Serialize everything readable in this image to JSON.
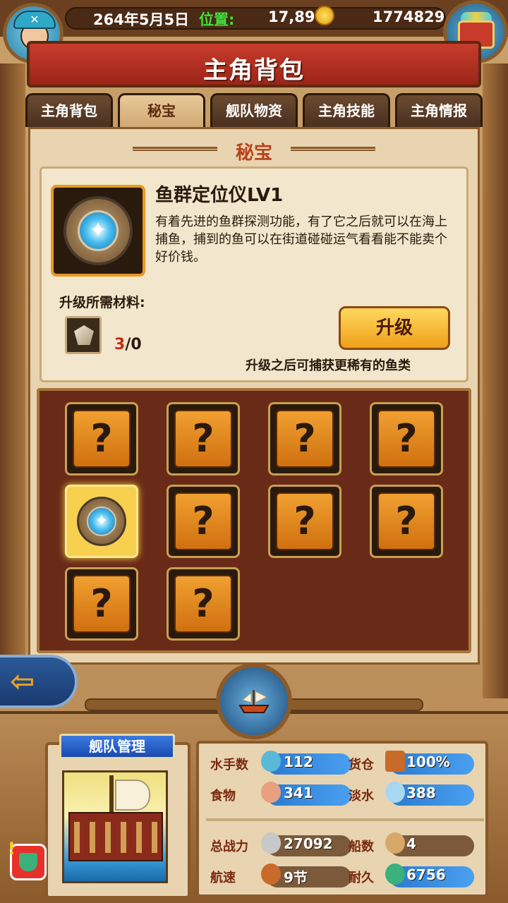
{
  "topbar": {
    "date": "264年5月5日",
    "position_label": "位置:",
    "position_value": "17,89",
    "gold": "1774829"
  },
  "title": "主角背包",
  "tabs": [
    {
      "label": "主角背包",
      "active": false
    },
    {
      "label": "秘宝",
      "active": true
    },
    {
      "label": "舰队物资",
      "active": false
    },
    {
      "label": "主角技能",
      "active": false
    },
    {
      "label": "主角情报",
      "active": false
    }
  ],
  "section_title": "秘宝",
  "item": {
    "name": "鱼群定位仪LV1",
    "description": "有着先进的鱼群探测功能，有了它之后就可以在海上捕鱼，捕到的鱼可以在街道碰碰运气看看能不能卖个好价钱。",
    "materials_label": "升级所需材料:",
    "material_have": "3",
    "material_need": "/0",
    "upgrade_button": "升级",
    "upgrade_hint": "升级之后可捕获更稀有的鱼类"
  },
  "grid": {
    "slots": [
      {
        "content": "?"
      },
      {
        "content": "?"
      },
      {
        "content": "?"
      },
      {
        "content": "?"
      },
      {
        "content": "compass",
        "selected": true
      },
      {
        "content": "?"
      },
      {
        "content": "?"
      },
      {
        "content": "?"
      },
      {
        "content": "?"
      },
      {
        "content": "?"
      }
    ]
  },
  "fleet": {
    "title": "舰队管理"
  },
  "stats": {
    "sailors_label": "水手数",
    "sailors_value": "112",
    "cargo_label": "货仓",
    "cargo_value": "100%",
    "food_label": "食物",
    "food_value": "341",
    "water_label": "淡水",
    "water_value": "388",
    "power_label": "总战力",
    "power_value": "27092",
    "ships_label": "船数",
    "ships_value": "4",
    "speed_label": "航速",
    "speed_value": "9节",
    "durability_label": "耐久",
    "durability_value": "6756"
  },
  "colors": {
    "accent_red": "#c83c2c",
    "gold_button": "#f0a018",
    "stat_blue": "#2a7ad0",
    "have_count": "#c82a1a"
  },
  "icons": [
    "avatar-icon",
    "treasure-chest-icon",
    "coin-icon",
    "compass-icon",
    "shell-material-icon",
    "question-mark-icon",
    "back-arrow-icon",
    "ship-helm-icon",
    "alert-icon"
  ]
}
